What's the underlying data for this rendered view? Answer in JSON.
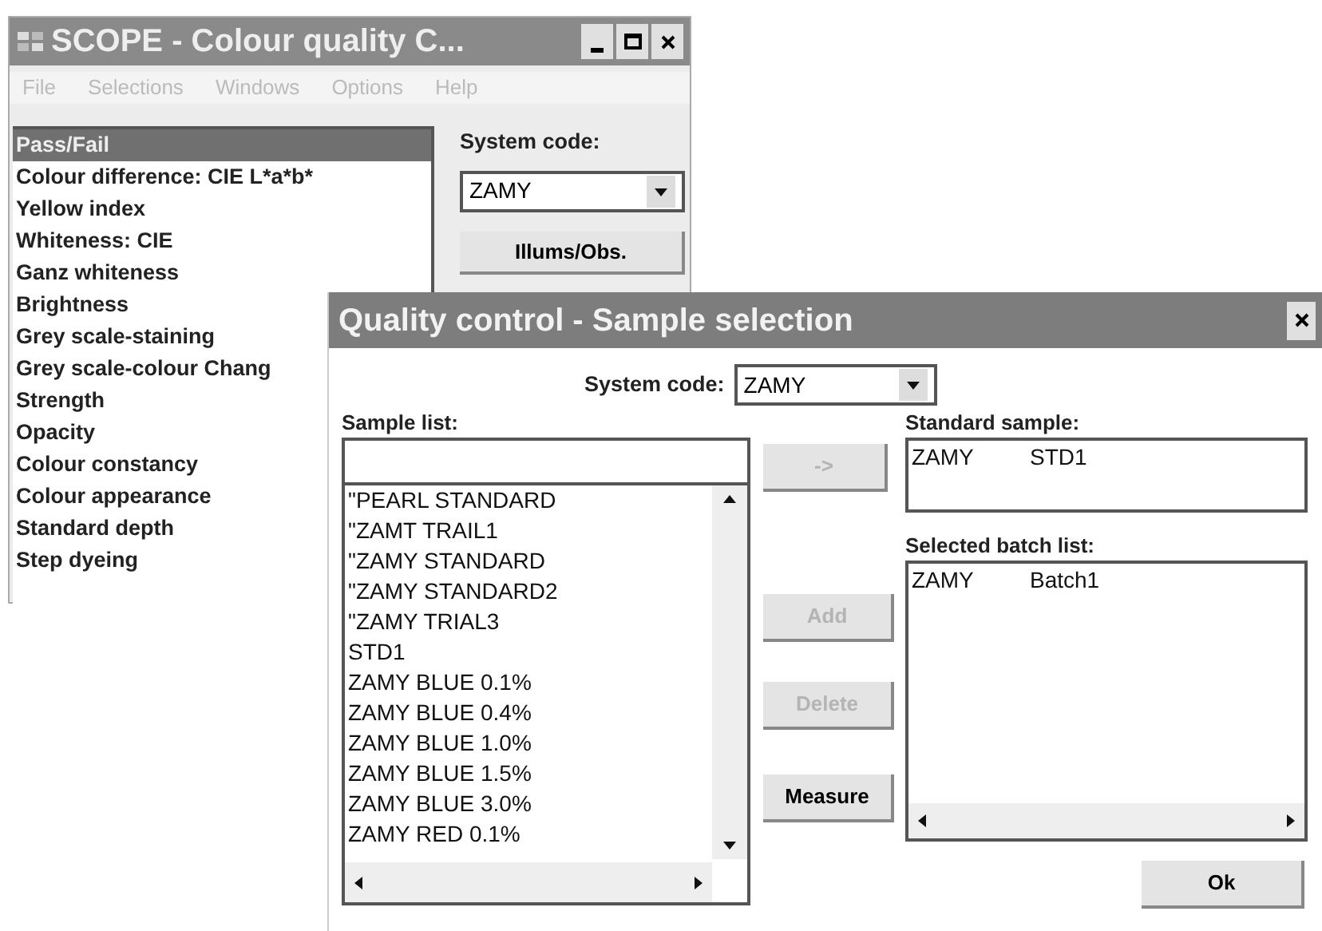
{
  "main_window": {
    "title": "SCOPE - Colour quality C...",
    "menu": [
      {
        "label": "File",
        "disabled": true
      },
      {
        "label": "Selections",
        "disabled": true
      },
      {
        "label": "Windows",
        "disabled": true
      },
      {
        "label": "Options",
        "disabled": true
      },
      {
        "label": "Help",
        "disabled": true
      }
    ],
    "tests": [
      {
        "label": "Pass/Fail",
        "selected": true
      },
      {
        "label": "Colour difference: CIE L*a*b*",
        "selected": false
      },
      {
        "label": "Yellow index",
        "selected": false
      },
      {
        "label": "Whiteness: CIE",
        "selected": false
      },
      {
        "label": "Ganz whiteness",
        "selected": false
      },
      {
        "label": "Brightness",
        "selected": false
      },
      {
        "label": "Grey scale-staining",
        "selected": false
      },
      {
        "label": "Grey scale-colour Chang",
        "selected": false
      },
      {
        "label": "Strength",
        "selected": false
      },
      {
        "label": "Opacity",
        "selected": false
      },
      {
        "label": "Colour constancy",
        "selected": false
      },
      {
        "label": "Colour appearance",
        "selected": false
      },
      {
        "label": "Standard depth",
        "selected": false
      },
      {
        "label": "Step dyeing",
        "selected": false
      }
    ],
    "system_code_label": "System code:",
    "system_code": "ZAMY",
    "illums_button": "Illums/Obs."
  },
  "dialog": {
    "title": "Quality control - Sample selection",
    "system_code_label": "System code:",
    "system_code": "ZAMY",
    "sample_list_label": "Sample list:",
    "samples": [
      "\"PEARL STANDARD",
      "\"ZAMT TRAIL1",
      "\"ZAMY STANDARD",
      "\"ZAMY STANDARD2",
      "\"ZAMY TRIAL3",
      "STD1",
      "ZAMY BLUE 0.1%",
      "ZAMY BLUE 0.4%",
      "ZAMY BLUE 1.0%",
      "ZAMY BLUE 1.5%",
      "ZAMY BLUE 3.0%",
      "ZAMY RED 0.1%"
    ],
    "buttons": [
      {
        "label": "->",
        "disabled": true
      },
      {
        "label": "Add",
        "disabled": true
      },
      {
        "label": "Delete",
        "disabled": true
      },
      {
        "label": "Measure",
        "disabled": false
      }
    ],
    "standard_sample_label": "Standard sample:",
    "standard_sample": [
      {
        "code": "ZAMY",
        "name": "STD1"
      }
    ],
    "batch_list_label": "Selected batch list:",
    "batches": [
      {
        "code": "ZAMY",
        "name": "Batch1"
      }
    ],
    "ok_button": "Ok"
  }
}
